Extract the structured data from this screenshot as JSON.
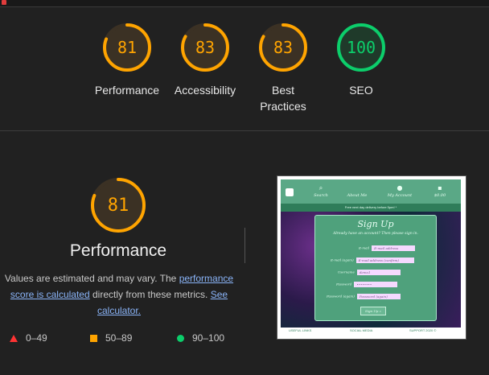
{
  "colors": {
    "average": "#ffa400",
    "pass": "#0cce6b",
    "fail": "#ff3333"
  },
  "summary": [
    {
      "score": 81,
      "label": "Performance",
      "status": "average"
    },
    {
      "score": 83,
      "label": "Accessibility",
      "status": "average"
    },
    {
      "score": 83,
      "label": "Best Practices",
      "status": "average"
    },
    {
      "score": 100,
      "label": "SEO",
      "status": "pass"
    }
  ],
  "detail": {
    "score": 81,
    "status": "average",
    "title": "Performance",
    "desc_1": "Values are estimated and may vary. The",
    "link_score": "performance score is calculated",
    "desc_2": "directly from these metrics.",
    "link_calculator": "See calculator."
  },
  "legend": [
    {
      "icon": "fail-triangle-icon",
      "range": "0–49"
    },
    {
      "icon": "average-square-icon",
      "range": "50–89"
    },
    {
      "icon": "pass-circle-icon",
      "range": "90–100"
    }
  ],
  "screenshot": {
    "nav": [
      "Search",
      "About Me",
      "My Account",
      "$0.00"
    ],
    "banner": "Free next day delivery before 5pm! *",
    "form_title": "Sign Up",
    "form_sub": "Already have an account? Then please sign in.",
    "fields": [
      {
        "label": "E-mail",
        "value": "E-mail address"
      },
      {
        "label": "E-mail (again)",
        "value": "E-mail address (confirm)"
      },
      {
        "label": "Username",
        "value": "demo1"
      },
      {
        "label": "Password",
        "value": "••••••••"
      },
      {
        "label": "Password (again)",
        "value": "Password (again)"
      }
    ],
    "button": "Sign Up »",
    "footer": [
      "USEFUL LINKS",
      "SOCIAL MEDIA",
      "SUPPORT 2020 ©"
    ]
  }
}
